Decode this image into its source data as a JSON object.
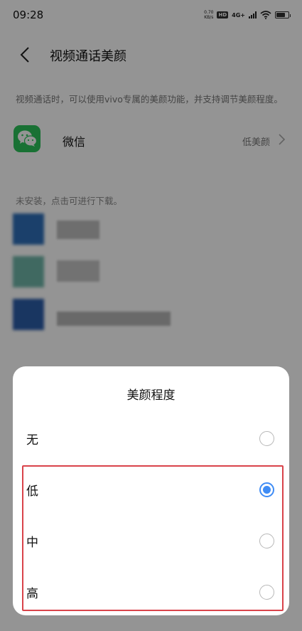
{
  "status_bar": {
    "time": "09:28",
    "net_speed_value": "0.70",
    "net_speed_unit": "KB/s",
    "hd_badge": "HD",
    "network_type": "4G+"
  },
  "header": {
    "title": "视频通话美颜"
  },
  "description": "视频通话时，可以使用vivo专属的美颜功能，并支持调节美颜程度。",
  "app": {
    "name": "微信",
    "value": "低美颜"
  },
  "not_installed_hint": "未安装，点击可进行下载。",
  "sheet": {
    "title": "美颜程度",
    "options": [
      {
        "label": "无",
        "selected": false
      },
      {
        "label": "低",
        "selected": true
      },
      {
        "label": "中",
        "selected": false
      },
      {
        "label": "高",
        "selected": false
      }
    ]
  },
  "colors": {
    "accent": "#3f8cf5",
    "highlight": "#d9434a",
    "wechat_green": "#2bc35a"
  }
}
